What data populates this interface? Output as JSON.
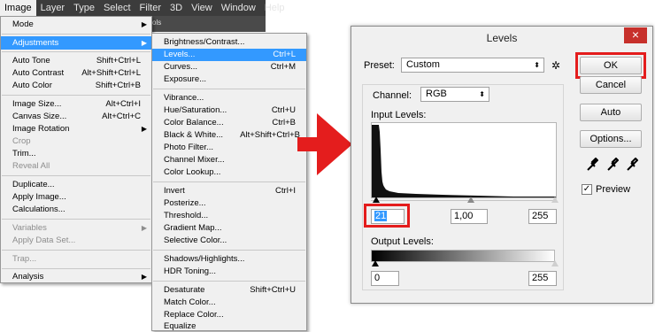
{
  "menubar": {
    "items": [
      "Image",
      "Layer",
      "Type",
      "Select",
      "Filter",
      "3D",
      "View",
      "Window",
      "Help"
    ]
  },
  "image_menu": {
    "items": [
      {
        "label": "Mode",
        "submenu": true
      },
      {
        "label": "Adjustments",
        "submenu": true
      },
      {
        "label": "Auto Tone",
        "shortcut": "Shift+Ctrl+L"
      },
      {
        "label": "Auto Contrast",
        "shortcut": "Alt+Shift+Ctrl+L"
      },
      {
        "label": "Auto Color",
        "shortcut": "Shift+Ctrl+B"
      },
      {
        "label": "Image Size...",
        "shortcut": "Alt+Ctrl+I"
      },
      {
        "label": "Canvas Size...",
        "shortcut": "Alt+Ctrl+C"
      },
      {
        "label": "Image Rotation",
        "submenu": true
      },
      {
        "label": "Crop",
        "disabled": true
      },
      {
        "label": "Trim..."
      },
      {
        "label": "Reveal All",
        "disabled": true
      },
      {
        "label": "Duplicate..."
      },
      {
        "label": "Apply Image..."
      },
      {
        "label": "Calculations..."
      },
      {
        "label": "Variables",
        "submenu": true,
        "disabled": true
      },
      {
        "label": "Apply Data Set...",
        "disabled": true
      },
      {
        "label": "Trap...",
        "disabled": true
      },
      {
        "label": "Analysis",
        "submenu": true
      }
    ]
  },
  "adjustments_menu": {
    "items": [
      {
        "label": "Brightness/Contrast..."
      },
      {
        "label": "Levels...",
        "shortcut": "Ctrl+L"
      },
      {
        "label": "Curves...",
        "shortcut": "Ctrl+M"
      },
      {
        "label": "Exposure..."
      },
      {
        "label": "Vibrance..."
      },
      {
        "label": "Hue/Saturation...",
        "shortcut": "Ctrl+U"
      },
      {
        "label": "Color Balance...",
        "shortcut": "Ctrl+B"
      },
      {
        "label": "Black & White...",
        "shortcut": "Alt+Shift+Ctrl+B"
      },
      {
        "label": "Photo Filter..."
      },
      {
        "label": "Channel Mixer..."
      },
      {
        "label": "Color Lookup..."
      },
      {
        "label": "Invert",
        "shortcut": "Ctrl+I"
      },
      {
        "label": "Posterize..."
      },
      {
        "label": "Threshold..."
      },
      {
        "label": "Gradient Map..."
      },
      {
        "label": "Selective Color..."
      },
      {
        "label": "Shadows/Highlights..."
      },
      {
        "label": "HDR Toning..."
      },
      {
        "label": "Desaturate",
        "shortcut": "Shift+Ctrl+U"
      },
      {
        "label": "Match Color..."
      },
      {
        "label": "Replace Color..."
      },
      {
        "label": "Equalize"
      }
    ]
  },
  "toolbar_fragment": "ols",
  "levels_dialog": {
    "title": "Levels",
    "close_glyph": "×",
    "preset_label": "Preset:",
    "preset_value": "Custom",
    "channel_label": "Channel:",
    "channel_value": "RGB",
    "input_levels_label": "Input Levels:",
    "input_black": "21",
    "input_gamma": "1,00",
    "input_white": "255",
    "output_levels_label": "Output Levels:",
    "output_black": "0",
    "output_white": "255",
    "ok_label": "OK",
    "cancel_label": "Cancel",
    "auto_label": "Auto",
    "options_label": "Options...",
    "preview_label": "Preview",
    "preview_checked": true
  },
  "colors": {
    "highlight": "#3399ff",
    "annotation_red": "#e41d1d",
    "menubar_bg": "#3c3c3c"
  }
}
